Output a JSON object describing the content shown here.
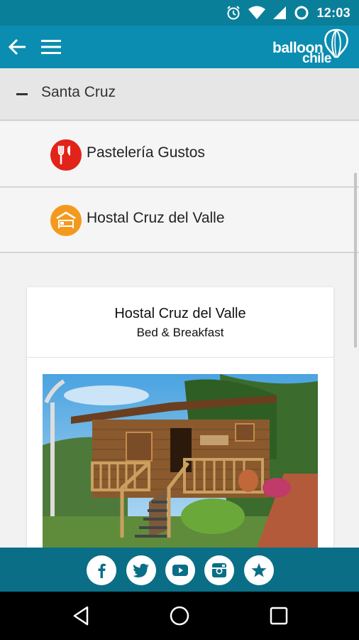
{
  "status": {
    "time": "12:03"
  },
  "appbar": {
    "logo_line1": "balloon",
    "logo_line2": "chile",
    "accent": "#0a8db0"
  },
  "section": {
    "title": "Santa Cruz",
    "state": "expanded"
  },
  "items": [
    {
      "label": "Pastelería Gustos",
      "icon": "restaurant-icon",
      "color": "#e2231a"
    },
    {
      "label": "Hostal Cruz del Valle",
      "icon": "bed-icon",
      "color": "#f39a1e"
    }
  ],
  "card": {
    "title": "Hostal Cruz del Valle",
    "subtitle": "Bed & Breakfast",
    "image": "wooden-cabin-photo"
  },
  "social": [
    "facebook-icon",
    "twitter-icon",
    "youtube-icon",
    "instagram-icon",
    "star-icon"
  ],
  "navigation": [
    "back-icon",
    "home-icon",
    "recents-icon"
  ]
}
